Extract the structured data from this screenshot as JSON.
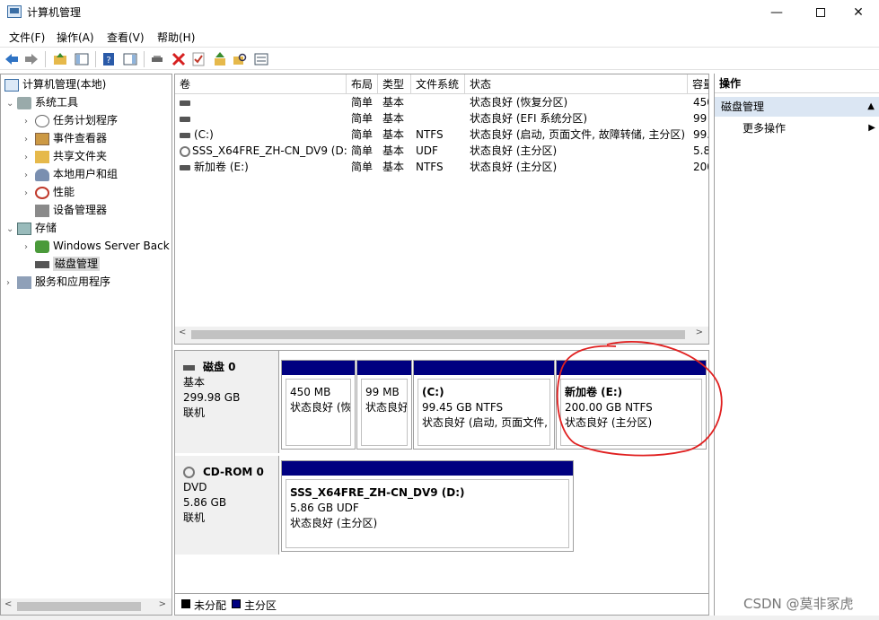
{
  "window": {
    "title": "计算机管理"
  },
  "menu": [
    {
      "label": "文件(F)"
    },
    {
      "label": "操作(A)"
    },
    {
      "label": "查看(V)"
    },
    {
      "label": "帮助(H)"
    }
  ],
  "window_controls": {
    "minimize": "—",
    "close": "✕"
  },
  "tree": {
    "root": "计算机管理(本地)",
    "items": [
      {
        "label": "系统工具",
        "icon": "tools-icon",
        "expander": "⌄"
      },
      {
        "label": "任务计划程序",
        "icon": "clock-icon",
        "expander": "›"
      },
      {
        "label": "事件查看器",
        "icon": "event-viewer-icon",
        "expander": "›"
      },
      {
        "label": "共享文件夹",
        "icon": "shared-folder-icon",
        "expander": "›"
      },
      {
        "label": "本地用户和组",
        "icon": "users-icon",
        "expander": "›"
      },
      {
        "label": "性能",
        "icon": "performance-icon",
        "expander": "›"
      },
      {
        "label": "设备管理器",
        "icon": "device-manager-icon",
        "expander": ""
      },
      {
        "label": "存储",
        "icon": "storage-icon",
        "expander": "⌄"
      },
      {
        "label": "Windows Server Back",
        "icon": "backup-icon",
        "expander": "›"
      },
      {
        "label": "磁盘管理",
        "icon": "disk-management-icon",
        "expander": ""
      },
      {
        "label": "服务和应用程序",
        "icon": "services-icon",
        "expander": "›"
      }
    ]
  },
  "volume_list": {
    "columns": [
      "卷",
      "布局",
      "类型",
      "文件系统",
      "状态",
      "容量"
    ],
    "rows": [
      {
        "volume": "",
        "layout": "简单",
        "type": "基本",
        "fs": "",
        "status": "状态良好 (恢复分区)",
        "capacity": "450"
      },
      {
        "volume": "",
        "layout": "简单",
        "type": "基本",
        "fs": "",
        "status": "状态良好 (EFI 系统分区)",
        "capacity": "99"
      },
      {
        "volume": "(C:)",
        "layout": "简单",
        "type": "基本",
        "fs": "NTFS",
        "status": "状态良好 (启动, 页面文件, 故障转储, 主分区)",
        "capacity": "99."
      },
      {
        "volume": "SSS_X64FRE_ZH-CN_DV9 (D:)",
        "layout": "简单",
        "type": "基本",
        "fs": "UDF",
        "status": "状态良好 (主分区)",
        "capacity": "5.8"
      },
      {
        "volume": "新加卷 (E:)",
        "layout": "简单",
        "type": "基本",
        "fs": "NTFS",
        "status": "状态良好 (主分区)",
        "capacity": "200"
      }
    ]
  },
  "disks": [
    {
      "name": "磁盘 0",
      "kind": "基本",
      "size": "299.98 GB",
      "state": "联机",
      "partitions": [
        {
          "name": "",
          "size": "450 MB",
          "status": "状态良好 (恢"
        },
        {
          "name": "",
          "size": "99 MB",
          "status": "状态良好"
        },
        {
          "name": "(C:)",
          "size": "99.45 GB NTFS",
          "status": "状态良好 (启动, 页面文件,"
        },
        {
          "name": "新加卷 (E:)",
          "size": "200.00 GB NTFS",
          "status": "状态良好 (主分区)"
        }
      ]
    },
    {
      "name": "CD-ROM 0",
      "kind": "DVD",
      "size": "5.86 GB",
      "state": "联机",
      "partitions": [
        {
          "name": "SSS_X64FRE_ZH-CN_DV9 (D:)",
          "size": "5.86 GB UDF",
          "status": "状态良好 (主分区)"
        }
      ]
    }
  ],
  "legend": [
    {
      "label": "未分配",
      "color": "#000000"
    },
    {
      "label": "主分区",
      "color": "#000080"
    }
  ],
  "actions": {
    "header": "操作",
    "section": "磁盘管理",
    "items": [
      "更多操作"
    ]
  },
  "watermark": "CSDN @莫非冢虎",
  "colors": {
    "primary_partition": "#000080",
    "annotation": "#e02020",
    "selection": "#dbe6f3"
  }
}
